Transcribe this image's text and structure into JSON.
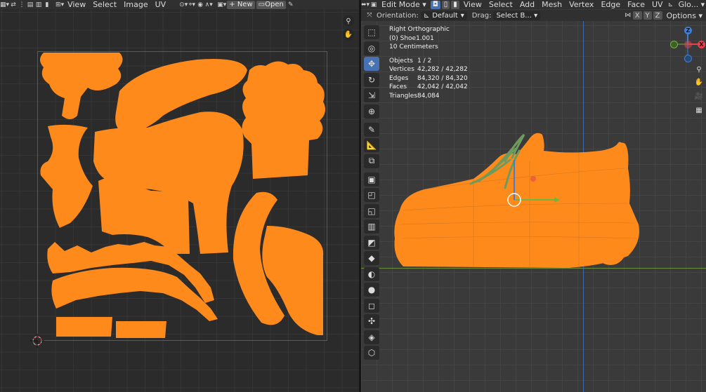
{
  "uv_editor": {
    "menu": [
      "View",
      "Select",
      "Image",
      "UV"
    ],
    "new_label": "New",
    "open_label": "Open"
  },
  "viewport": {
    "mode_label": "Edit Mode",
    "menu": [
      "View",
      "Select",
      "Add",
      "Mesh",
      "Vertex",
      "Edge",
      "Face",
      "UV"
    ],
    "transform_label": "Glo...",
    "orientation_label": "Orientation:",
    "orientation_value": "Default",
    "drag_label": "Drag:",
    "drag_value": "Select B...",
    "axes": [
      "X",
      "Y",
      "Z"
    ],
    "options_label": "Options",
    "info": {
      "view_name": "Right Orthographic",
      "object_name": "(0) Shoe1.001",
      "scale": "10 Centimeters",
      "stats": [
        {
          "label": "Objects",
          "value": "1 / 2"
        },
        {
          "label": "Vertices",
          "value": "42,282 / 42,282"
        },
        {
          "label": "Edges",
          "value": "84,320 / 84,320"
        },
        {
          "label": "Faces",
          "value": "42,042 / 42,042"
        },
        {
          "label": "Triangles",
          "value": "84,084"
        }
      ]
    },
    "gizmo": {
      "x": "X",
      "y": "Y",
      "z": "Z"
    }
  },
  "colors": {
    "mesh_orange": "#ff8a1c",
    "active_blue": "#4772b3",
    "x_axis": "#e8414e",
    "y_axis": "#6fb63e",
    "z_axis": "#3d7fd9",
    "lace_green": "#6e9a5e"
  }
}
